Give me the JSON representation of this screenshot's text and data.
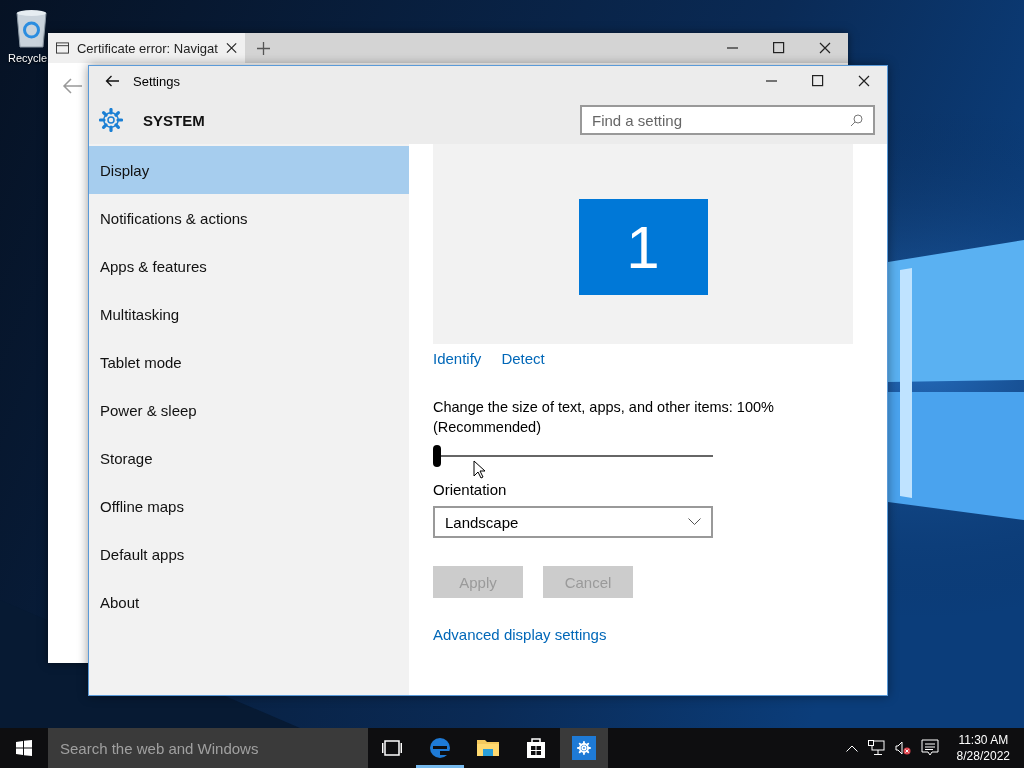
{
  "desktop": {
    "icons": [
      {
        "label": "Recycle"
      }
    ]
  },
  "browser_window": {
    "tab_title": "Certificate error: Navigat"
  },
  "settings_window": {
    "title": "Settings",
    "section": "SYSTEM",
    "search": {
      "placeholder": "Find a setting"
    },
    "sidebar": {
      "items": [
        {
          "label": "Display",
          "selected": true
        },
        {
          "label": "Notifications & actions",
          "selected": false
        },
        {
          "label": "Apps & features",
          "selected": false
        },
        {
          "label": "Multitasking",
          "selected": false
        },
        {
          "label": "Tablet mode",
          "selected": false
        },
        {
          "label": "Power & sleep",
          "selected": false
        },
        {
          "label": "Storage",
          "selected": false
        },
        {
          "label": "Offline maps",
          "selected": false
        },
        {
          "label": "Default apps",
          "selected": false
        },
        {
          "label": "About",
          "selected": false
        }
      ]
    },
    "display": {
      "monitor_number": "1",
      "links": [
        "Identify",
        "Detect"
      ],
      "scale_label": "Change the size of text, apps, and other items: 100% (Recommended)",
      "scale_slider": {
        "level": 0
      },
      "orientation_label": "Orientation",
      "orientation": {
        "value": "Landscape"
      },
      "buttons": [
        {
          "label": "Apply",
          "disabled": true
        },
        {
          "label": "Cancel",
          "disabled": true
        }
      ],
      "advanced_link": "Advanced display settings"
    }
  },
  "taskbar": {
    "search": {
      "placeholder": "Search the web and Windows"
    },
    "apps": [
      {
        "kind": "browser",
        "running": true,
        "selected": false
      },
      {
        "kind": "folder",
        "running": false,
        "selected": false
      },
      {
        "kind": "store",
        "running": false,
        "selected": false
      },
      {
        "kind": "settings",
        "running": false,
        "selected": true
      }
    ],
    "clock": {
      "time": "11:30 AM",
      "date": "8/28/2022"
    }
  }
}
